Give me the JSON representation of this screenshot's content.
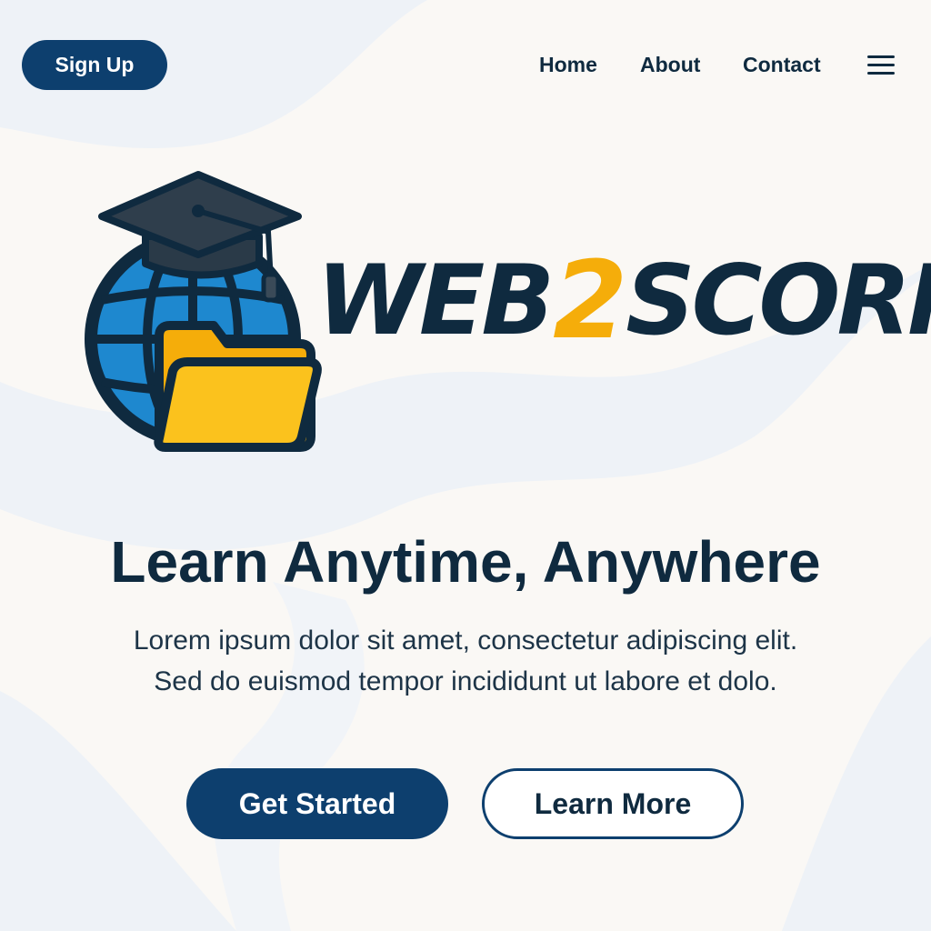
{
  "header": {
    "signup_label": "Sign Up",
    "nav": {
      "home": "Home",
      "about": "About",
      "contact": "Contact"
    },
    "menu_icon": "hamburger-menu-icon"
  },
  "logo": {
    "emblem_icons": [
      "globe-icon",
      "graduation-cap-icon",
      "folder-icon"
    ],
    "wordmark_part1": "WEB",
    "wordmark_part2": "2",
    "wordmark_part3": "SCORM"
  },
  "hero": {
    "headline": "Learn Anytime, Anywhere",
    "subtext_line1": "Lorem ipsum dolor sit amet, consectetur adipiscing elit.",
    "subtext_line2": "Sed do euismod tempor incididunt ut labore et dolo.",
    "primary_cta": "Get Started",
    "secondary_cta": "Learn More"
  },
  "colors": {
    "primary": "#0d3f6e",
    "text_dark": "#0f2a3f",
    "accent": "#f5ad0a",
    "globe_blue": "#1e88cf",
    "background": "#faf8f5"
  }
}
